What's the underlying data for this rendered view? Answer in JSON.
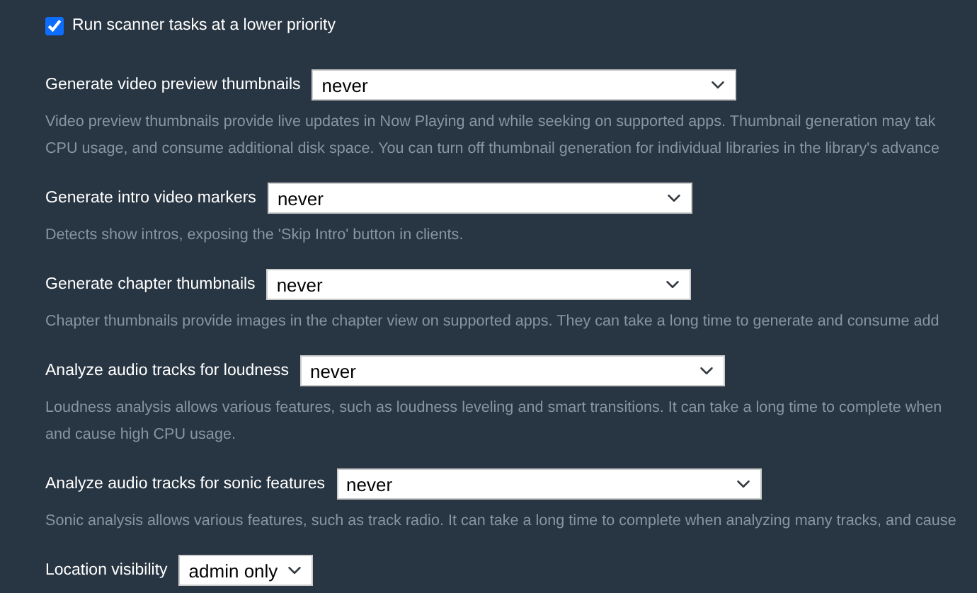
{
  "checkbox": {
    "label": "Run scanner tasks at a lower priority",
    "checked": true
  },
  "settings": [
    {
      "label": "Generate video preview thumbnails",
      "value": "never",
      "description": [
        "Video preview thumbnails provide live updates in Now Playing and while seeking on supported apps. Thumbnail generation may tak",
        "CPU usage, and consume additional disk space. You can turn off thumbnail generation for individual libraries in the library's advance"
      ]
    },
    {
      "label": "Generate intro video markers",
      "value": "never",
      "description": [
        "Detects show intros, exposing the 'Skip Intro' button in clients."
      ]
    },
    {
      "label": "Generate chapter thumbnails",
      "value": "never",
      "description": [
        "Chapter thumbnails provide images in the chapter view on supported apps. They can take a long time to generate and consume add"
      ]
    },
    {
      "label": "Analyze audio tracks for loudness",
      "value": "never",
      "description": [
        "Loudness analysis allows various features, such as loudness leveling and smart transitions. It can take a long time to complete when",
        "and cause high CPU usage."
      ]
    },
    {
      "label": "Analyze audio tracks for sonic features",
      "value": "never",
      "description": [
        "Sonic analysis allows various features, such as track radio. It can take a long time to complete when analyzing many tracks, and cause"
      ]
    },
    {
      "label": "Location visibility",
      "value": "admin only"
    }
  ]
}
